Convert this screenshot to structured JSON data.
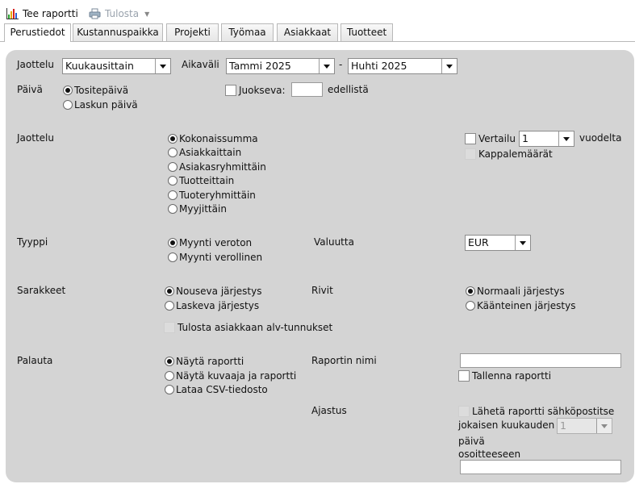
{
  "toolbar": {
    "make_report_label": "Tee raportti",
    "print_label": "Tulosta"
  },
  "tabs": [
    {
      "label": "Perustiedot"
    },
    {
      "label": "Kustannuspaikka"
    },
    {
      "label": "Projekti"
    },
    {
      "label": "Työmaa"
    },
    {
      "label": "Asiakkaat"
    },
    {
      "label": "Tuotteet"
    }
  ],
  "period": {
    "label": "Jaottelu",
    "value": "Kuukausittain",
    "range_label": "Aikaväli",
    "range_from": "Tammi 2025",
    "range_sep": "-",
    "range_to": "Huhti 2025"
  },
  "date": {
    "label": "Päivä",
    "options": [
      "Tositepäivä",
      "Laskun päivä"
    ],
    "running_label": "Juokseva:",
    "running_value": "",
    "running_suffix": "edellistä"
  },
  "grouping": {
    "label": "Jaottelu",
    "options": [
      "Kokonaissumma",
      "Asiakkaittain",
      "Asiakasryhmittäin",
      "Tuotteittain",
      "Tuoteryhmittäin",
      "Myyjittäin"
    ],
    "compare_label": "Vertailu",
    "compare_value": "1",
    "compare_suffix": "vuodelta",
    "quantities_label": "Kappalemäärät"
  },
  "type": {
    "label": "Tyyppi",
    "options": [
      "Myynti veroton",
      "Myynti verollinen"
    ],
    "currency_label": "Valuutta",
    "currency_value": "EUR"
  },
  "columns": {
    "label": "Sarakkeet",
    "options": [
      "Nouseva järjestys",
      "Laskeva järjestys"
    ],
    "rows_label": "Rivit",
    "rows_options": [
      "Normaali järjestys",
      "Käänteinen järjestys"
    ],
    "vat_label": "Tulosta asiakkaan alv-tunnukset"
  },
  "output": {
    "label": "Palauta",
    "options": [
      "Näytä raportti",
      "Näytä kuvaaja ja raportti",
      "Lataa CSV-tiedosto"
    ],
    "report_name_label": "Raportin nimi",
    "report_name_value": "",
    "save_label": "Tallenna raportti"
  },
  "schedule": {
    "label": "Ajastus",
    "email_label": "Lähetä raportti sähköpostitse",
    "each_month_label": "jokaisen kuukauden",
    "day_value": "1",
    "day_label": "päivä",
    "address_label": "osoitteeseen",
    "address_value": ""
  },
  "colors": {
    "panel": "#d4d4d4",
    "chart_bars": [
      "#2aa02a",
      "#e6a800",
      "#d62020"
    ]
  }
}
